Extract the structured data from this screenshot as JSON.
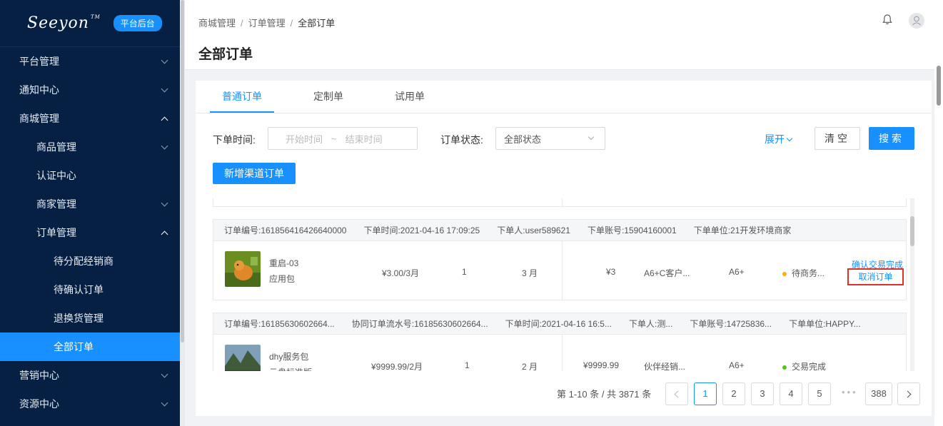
{
  "sidebar": {
    "logo": "Seeyon",
    "logo_tm": "TM",
    "badge": "平台后台",
    "items": [
      {
        "label": "平台管理"
      },
      {
        "label": "通知中心"
      },
      {
        "label": "商城管理"
      },
      {
        "label": "商品管理"
      },
      {
        "label": "认证中心"
      },
      {
        "label": "商家管理"
      },
      {
        "label": "订单管理"
      },
      {
        "label": "待分配经销商"
      },
      {
        "label": "待确认订单"
      },
      {
        "label": "退换货管理"
      },
      {
        "label": "全部订单"
      },
      {
        "label": "营销中心"
      },
      {
        "label": "资源中心"
      }
    ]
  },
  "header": {
    "breadcrumb": [
      "商城管理",
      "订单管理",
      "全部订单"
    ],
    "separator": "/",
    "title": "全部订单"
  },
  "tabs": [
    "普通订单",
    "定制单",
    "试用单"
  ],
  "filters": {
    "time_label": "下单时间:",
    "start_placeholder": "开始时间",
    "range_sep": "~",
    "end_placeholder": "结束时间",
    "status_label": "订单状态:",
    "status_value": "全部状态",
    "expand_label": "展开",
    "clear_label": "清空",
    "search_label": "搜索",
    "new_order_label": "新增渠道订单"
  },
  "orders": [
    {
      "head": [
        "订单编号:161856416426640000",
        "下单时间:2021-04-16 17:09:25",
        "下单人:user589621",
        "下单账号:15904160001",
        "下单单位:21开发环境商家"
      ],
      "name": "重启-03",
      "type": "应用包",
      "price": "¥3.00/3月",
      "qty": "1",
      "period": "3 月",
      "total": "¥3",
      "customer": "A6+C客户...",
      "edition": "A6+",
      "status": "待商务...",
      "status_color": "#faad14",
      "action1": "确认交易完成",
      "action2": "取消订单"
    },
    {
      "head": [
        "订单编号:16185630602664...",
        "协同订单流水号:16185630602664...",
        "下单时间:2021-04-16 16:5...",
        "下单人:测...",
        "下单账号:14725836...",
        "下单单位:HAPPY..."
      ],
      "name": "dhy服务包",
      "type": "云盘标准版",
      "price": "¥9999.99/2月",
      "qty": "1",
      "period": "2 月",
      "total": "¥9999.99",
      "customer": "伙伴经销...",
      "edition": "A6+",
      "status": "交易完成",
      "status_color": "#52c41a"
    }
  ],
  "pagination": {
    "total_text": "第 1-10 条 / 共 3871 条",
    "pages": [
      "1",
      "2",
      "3",
      "4",
      "5"
    ],
    "ellipsis": "•••",
    "last": "388"
  },
  "colors": {
    "accent": "#1890ff",
    "sidebar": "#062044",
    "highlight": "#e0302b"
  }
}
